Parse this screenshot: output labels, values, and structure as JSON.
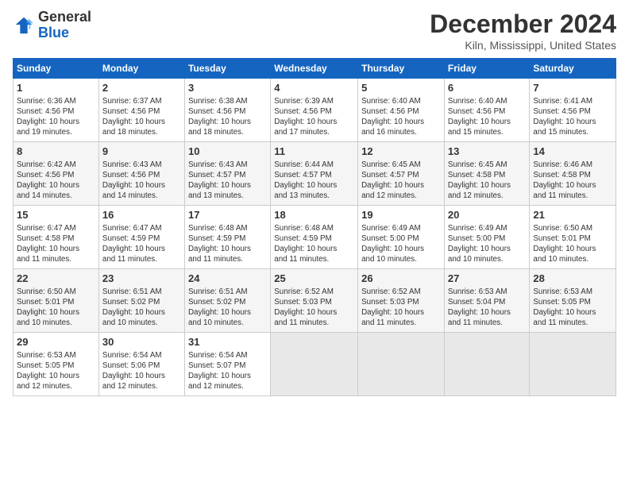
{
  "app": {
    "logo_general": "General",
    "logo_blue": "Blue",
    "title": "December 2024",
    "subtitle": "Kiln, Mississippi, United States"
  },
  "calendar": {
    "headers": [
      "Sunday",
      "Monday",
      "Tuesday",
      "Wednesday",
      "Thursday",
      "Friday",
      "Saturday"
    ],
    "weeks": [
      [
        {
          "day": "1",
          "info": "Sunrise: 6:36 AM\nSunset: 4:56 PM\nDaylight: 10 hours\nand 19 minutes."
        },
        {
          "day": "2",
          "info": "Sunrise: 6:37 AM\nSunset: 4:56 PM\nDaylight: 10 hours\nand 18 minutes."
        },
        {
          "day": "3",
          "info": "Sunrise: 6:38 AM\nSunset: 4:56 PM\nDaylight: 10 hours\nand 18 minutes."
        },
        {
          "day": "4",
          "info": "Sunrise: 6:39 AM\nSunset: 4:56 PM\nDaylight: 10 hours\nand 17 minutes."
        },
        {
          "day": "5",
          "info": "Sunrise: 6:40 AM\nSunset: 4:56 PM\nDaylight: 10 hours\nand 16 minutes."
        },
        {
          "day": "6",
          "info": "Sunrise: 6:40 AM\nSunset: 4:56 PM\nDaylight: 10 hours\nand 15 minutes."
        },
        {
          "day": "7",
          "info": "Sunrise: 6:41 AM\nSunset: 4:56 PM\nDaylight: 10 hours\nand 15 minutes."
        }
      ],
      [
        {
          "day": "8",
          "info": "Sunrise: 6:42 AM\nSunset: 4:56 PM\nDaylight: 10 hours\nand 14 minutes."
        },
        {
          "day": "9",
          "info": "Sunrise: 6:43 AM\nSunset: 4:56 PM\nDaylight: 10 hours\nand 14 minutes."
        },
        {
          "day": "10",
          "info": "Sunrise: 6:43 AM\nSunset: 4:57 PM\nDaylight: 10 hours\nand 13 minutes."
        },
        {
          "day": "11",
          "info": "Sunrise: 6:44 AM\nSunset: 4:57 PM\nDaylight: 10 hours\nand 13 minutes."
        },
        {
          "day": "12",
          "info": "Sunrise: 6:45 AM\nSunset: 4:57 PM\nDaylight: 10 hours\nand 12 minutes."
        },
        {
          "day": "13",
          "info": "Sunrise: 6:45 AM\nSunset: 4:58 PM\nDaylight: 10 hours\nand 12 minutes."
        },
        {
          "day": "14",
          "info": "Sunrise: 6:46 AM\nSunset: 4:58 PM\nDaylight: 10 hours\nand 11 minutes."
        }
      ],
      [
        {
          "day": "15",
          "info": "Sunrise: 6:47 AM\nSunset: 4:58 PM\nDaylight: 10 hours\nand 11 minutes."
        },
        {
          "day": "16",
          "info": "Sunrise: 6:47 AM\nSunset: 4:59 PM\nDaylight: 10 hours\nand 11 minutes."
        },
        {
          "day": "17",
          "info": "Sunrise: 6:48 AM\nSunset: 4:59 PM\nDaylight: 10 hours\nand 11 minutes."
        },
        {
          "day": "18",
          "info": "Sunrise: 6:48 AM\nSunset: 4:59 PM\nDaylight: 10 hours\nand 11 minutes."
        },
        {
          "day": "19",
          "info": "Sunrise: 6:49 AM\nSunset: 5:00 PM\nDaylight: 10 hours\nand 10 minutes."
        },
        {
          "day": "20",
          "info": "Sunrise: 6:49 AM\nSunset: 5:00 PM\nDaylight: 10 hours\nand 10 minutes."
        },
        {
          "day": "21",
          "info": "Sunrise: 6:50 AM\nSunset: 5:01 PM\nDaylight: 10 hours\nand 10 minutes."
        }
      ],
      [
        {
          "day": "22",
          "info": "Sunrise: 6:50 AM\nSunset: 5:01 PM\nDaylight: 10 hours\nand 10 minutes."
        },
        {
          "day": "23",
          "info": "Sunrise: 6:51 AM\nSunset: 5:02 PM\nDaylight: 10 hours\nand 10 minutes."
        },
        {
          "day": "24",
          "info": "Sunrise: 6:51 AM\nSunset: 5:02 PM\nDaylight: 10 hours\nand 10 minutes."
        },
        {
          "day": "25",
          "info": "Sunrise: 6:52 AM\nSunset: 5:03 PM\nDaylight: 10 hours\nand 11 minutes."
        },
        {
          "day": "26",
          "info": "Sunrise: 6:52 AM\nSunset: 5:03 PM\nDaylight: 10 hours\nand 11 minutes."
        },
        {
          "day": "27",
          "info": "Sunrise: 6:53 AM\nSunset: 5:04 PM\nDaylight: 10 hours\nand 11 minutes."
        },
        {
          "day": "28",
          "info": "Sunrise: 6:53 AM\nSunset: 5:05 PM\nDaylight: 10 hours\nand 11 minutes."
        }
      ],
      [
        {
          "day": "29",
          "info": "Sunrise: 6:53 AM\nSunset: 5:05 PM\nDaylight: 10 hours\nand 12 minutes."
        },
        {
          "day": "30",
          "info": "Sunrise: 6:54 AM\nSunset: 5:06 PM\nDaylight: 10 hours\nand 12 minutes."
        },
        {
          "day": "31",
          "info": "Sunrise: 6:54 AM\nSunset: 5:07 PM\nDaylight: 10 hours\nand 12 minutes."
        },
        {
          "day": "",
          "info": ""
        },
        {
          "day": "",
          "info": ""
        },
        {
          "day": "",
          "info": ""
        },
        {
          "day": "",
          "info": ""
        }
      ]
    ]
  }
}
